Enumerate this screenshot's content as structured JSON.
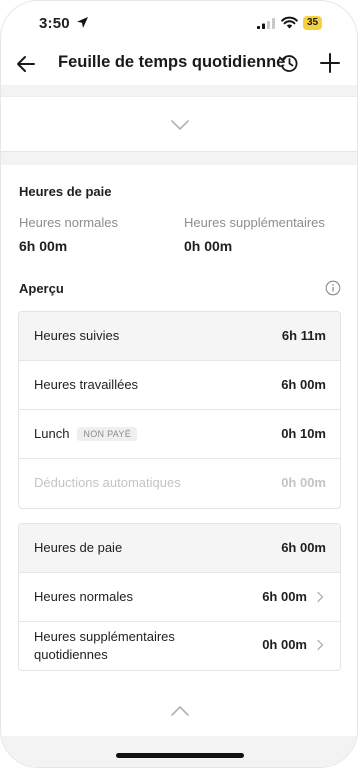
{
  "status_bar": {
    "time": "3:50",
    "battery": "35"
  },
  "header": {
    "title": "Feuille de temps quotidienne"
  },
  "pay_hours": {
    "title": "Heures de paie",
    "regular_label": "Heures normales",
    "regular_value": "6h 00m",
    "overtime_label": "Heures supplémentaires",
    "overtime_value": "0h 00m"
  },
  "overview": {
    "title": "Aperçu",
    "rows": [
      {
        "label": "Heures suivies",
        "value": "6h 11m"
      },
      {
        "label": "Heures travaillées",
        "value": "6h 00m"
      },
      {
        "label": "Lunch",
        "badge": "NON PAYÉ",
        "value": "0h 10m"
      },
      {
        "label": "Déductions automatiques",
        "value": "0h 00m"
      }
    ]
  },
  "pay_breakdown": {
    "rows": [
      {
        "label": "Heures de paie",
        "value": "6h 00m"
      },
      {
        "label": "Heures normales",
        "value": "6h 00m"
      },
      {
        "label_line1": "Heures supplémentaires",
        "label_line2": "quotidiennes",
        "value": "0h 00m"
      }
    ]
  },
  "colors": {
    "shaded_row": "#f5f5f5",
    "muted_text": "#c4c4c4",
    "battery": "#f5d142"
  }
}
